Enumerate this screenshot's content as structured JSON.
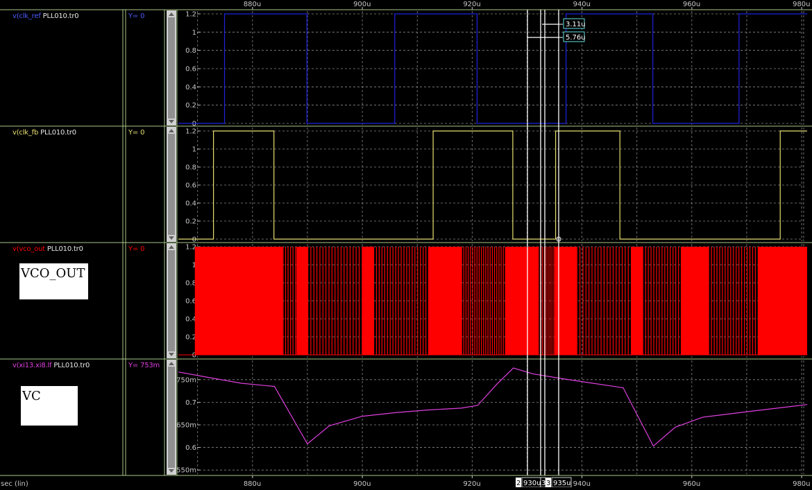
{
  "axis": {
    "top_ticks": [
      "880u",
      "900u",
      "920u",
      "940u",
      "960u",
      "980u"
    ],
    "bottom_ticks": [
      "880u",
      "900u",
      "920u",
      "940u",
      "960u",
      "980u"
    ],
    "x_label": "sec (lin)",
    "cursor_a": "2",
    "cursor_a_time": "930u",
    "cursor_b": "3",
    "cursor_b_time": "935u",
    "cursor_mid": "3"
  },
  "deltas": {
    "upper": "3.11u",
    "lower": "5.76u"
  },
  "panels": [
    {
      "label_prefix": "v(clk_ref",
      "file": "PLL010.tr0",
      "y_readout": "Y= 0",
      "color": "#1d24e0",
      "y_ticks": [
        "1.2",
        "1",
        "0.8",
        "0.6",
        "0.4",
        "0.2",
        "0"
      ]
    },
    {
      "label_prefix": "v(clk_fb",
      "file": "PLL010.tr0",
      "y_readout": "Y= 0",
      "color": "#e8e070",
      "y_ticks": [
        "1.2",
        "1",
        "0.8",
        "0.6",
        "0.4",
        "0.2",
        "0"
      ]
    },
    {
      "label_prefix": "v(vco_out",
      "file": "PLL010.tr0",
      "y_readout": "Y= 0",
      "color": "#ff0000",
      "annotation": "VCO_OUT",
      "y_ticks": [
        "1.2",
        "1",
        "0.8",
        "0.6",
        "0.4",
        "0.2",
        "0"
      ]
    },
    {
      "label_prefix": "v(xi13.xi8.lf",
      "file": "PLL010.tr0",
      "y_readout": "Y= 753m",
      "color": "#e040e0",
      "annotation": "VC",
      "y_ticks": [
        "750m",
        "0.7",
        "650m",
        "0.6",
        "550m"
      ]
    }
  ],
  "chart_data": [
    {
      "type": "line",
      "series": [
        {
          "name": "v(clk_ref",
          "x_unit": "us",
          "x": [
            866.5,
            874.9,
            874.9,
            889.9,
            889.9,
            905.9,
            905.9,
            920.9,
            920.9,
            937.1,
            937.1,
            952.9,
            952.9,
            968.6,
            968.6,
            981
          ],
          "y": [
            0,
            0,
            1.2,
            1.2,
            0,
            0,
            1.2,
            1.2,
            0,
            0,
            1.2,
            1.2,
            0,
            0,
            1.2,
            1.2
          ]
        }
      ],
      "xlim": [
        866.5,
        981
      ],
      "ylim": [
        -0.03,
        1.25
      ]
    },
    {
      "type": "line",
      "series": [
        {
          "name": "v(clk_fb",
          "x_unit": "us",
          "x": [
            866.5,
            872.9,
            872.9,
            883.9,
            883.9,
            912.9,
            912.9,
            927.4,
            927.4,
            935.2,
            935.2,
            946.9,
            946.9,
            976.1,
            976.1,
            981
          ],
          "y": [
            0,
            0,
            1.2,
            1.2,
            0,
            0,
            1.2,
            1.2,
            0,
            0,
            1.2,
            1.2,
            0,
            0,
            1.2,
            1.2
          ]
        }
      ],
      "xlim": [
        866.5,
        981
      ],
      "ylim": [
        -0.03,
        1.25
      ]
    },
    {
      "type": "area",
      "series": [
        {
          "name": "v(vco_out",
          "x_unit": "us",
          "dense_bands": [
            [
              869.5,
              885.5
            ],
            [
              888,
              890
            ],
            [
              900,
              902
            ],
            [
              912,
              918
            ],
            [
              926,
              932
            ],
            [
              935,
              939
            ],
            [
              949,
              951
            ],
            [
              958,
              963
            ],
            [
              972,
              981
            ]
          ],
          "y_range": [
            0,
            1.2
          ]
        }
      ],
      "xlim": [
        866.5,
        981
      ],
      "ylim": [
        -0.03,
        1.25
      ]
    },
    {
      "type": "line",
      "series": [
        {
          "name": "v(xi13.xi8.lf",
          "x_unit": "us",
          "x": [
            866.5,
            872,
            878,
            884,
            890,
            894,
            900,
            906,
            912,
            918,
            921,
            924.5,
            927.5,
            931,
            936,
            942,
            947.5,
            953,
            957,
            962,
            970,
            981
          ],
          "y": [
            0.767,
            0.755,
            0.742,
            0.735,
            0.608,
            0.648,
            0.669,
            0.677,
            0.683,
            0.687,
            0.693,
            0.74,
            0.776,
            0.763,
            0.753,
            0.742,
            0.732,
            0.603,
            0.645,
            0.667,
            0.679,
            0.695
          ]
        }
      ],
      "xlim": [
        866.5,
        981
      ],
      "ylim": [
        0.538,
        0.785
      ]
    }
  ]
}
